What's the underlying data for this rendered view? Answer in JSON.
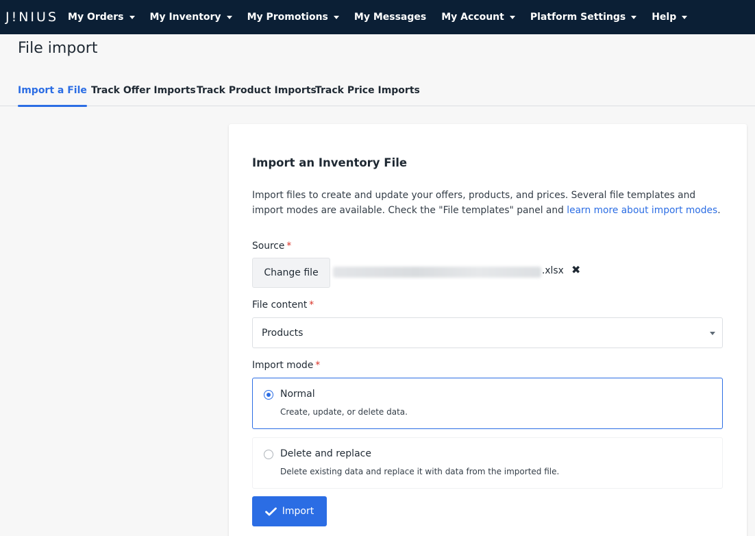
{
  "nav": {
    "logo": "J!NIUS",
    "items": [
      {
        "label": "My Orders",
        "dropdown": true
      },
      {
        "label": "My Inventory",
        "dropdown": true
      },
      {
        "label": "My Promotions",
        "dropdown": true
      },
      {
        "label": "My Messages",
        "dropdown": false
      },
      {
        "label": "My Account",
        "dropdown": true
      },
      {
        "label": "Platform Settings",
        "dropdown": true
      },
      {
        "label": "Help",
        "dropdown": true
      }
    ]
  },
  "page": {
    "title": "File import"
  },
  "tabs": [
    {
      "label": "Import a File",
      "active": true
    },
    {
      "label": "Track Offer Imports",
      "active": false
    },
    {
      "label": "Track Product Imports",
      "active": false
    },
    {
      "label": "Track Price Imports",
      "active": false
    }
  ],
  "card": {
    "title": "Import an Inventory File",
    "description_text": "Import files to create and update your offers, products, and prices. Several file templates and import modes are available. Check the \"File templates\" panel and ",
    "description_link": "learn more about import modes",
    "description_end": "."
  },
  "source": {
    "label": "Source",
    "required_mark": "*",
    "change_button": "Change file",
    "file_extension": ".xlsx",
    "remove_icon": "✖"
  },
  "file_content": {
    "label": "File content",
    "required_mark": "*",
    "selected": "Products"
  },
  "import_mode": {
    "label": "Import mode",
    "required_mark": "*",
    "options": [
      {
        "title": "Normal",
        "description": "Create, update, or delete data.",
        "selected": true
      },
      {
        "title": "Delete and replace",
        "description": "Delete existing data and replace it with data from the imported file.",
        "selected": false
      }
    ]
  },
  "actions": {
    "import_label": "Import"
  },
  "colors": {
    "nav_bg": "#0b1f35",
    "accent": "#2b6de4",
    "required": "#d93025",
    "page_bg": "#f7f7f7"
  }
}
